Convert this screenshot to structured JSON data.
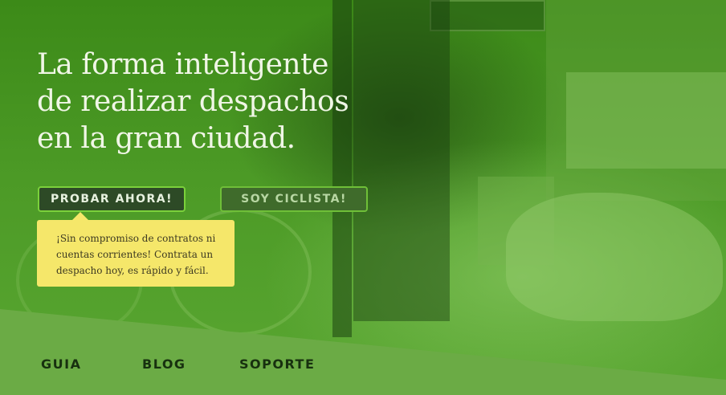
{
  "hero": {
    "headline_lines": [
      "La forma inteligente",
      "de realizar despachos",
      "en la gran ciudad."
    ]
  },
  "buttons": {
    "primary_label": "Probar ahora!",
    "secondary_label": "Soy ciclista!"
  },
  "tooltip": {
    "text": "¡Sin compromiso de contratos ni cuentas corrientes! Contrata un despacho hoy, es rápido y fácil."
  },
  "footer_nav": {
    "items": [
      "Guia",
      "Blog",
      "Soporte"
    ]
  },
  "colors": {
    "hero_overlay": "#4c9a26",
    "footer_band": "#6bab45",
    "tooltip_bg": "#f5e76a",
    "button_border": "#7bd13b",
    "nav_text": "#17300f"
  }
}
